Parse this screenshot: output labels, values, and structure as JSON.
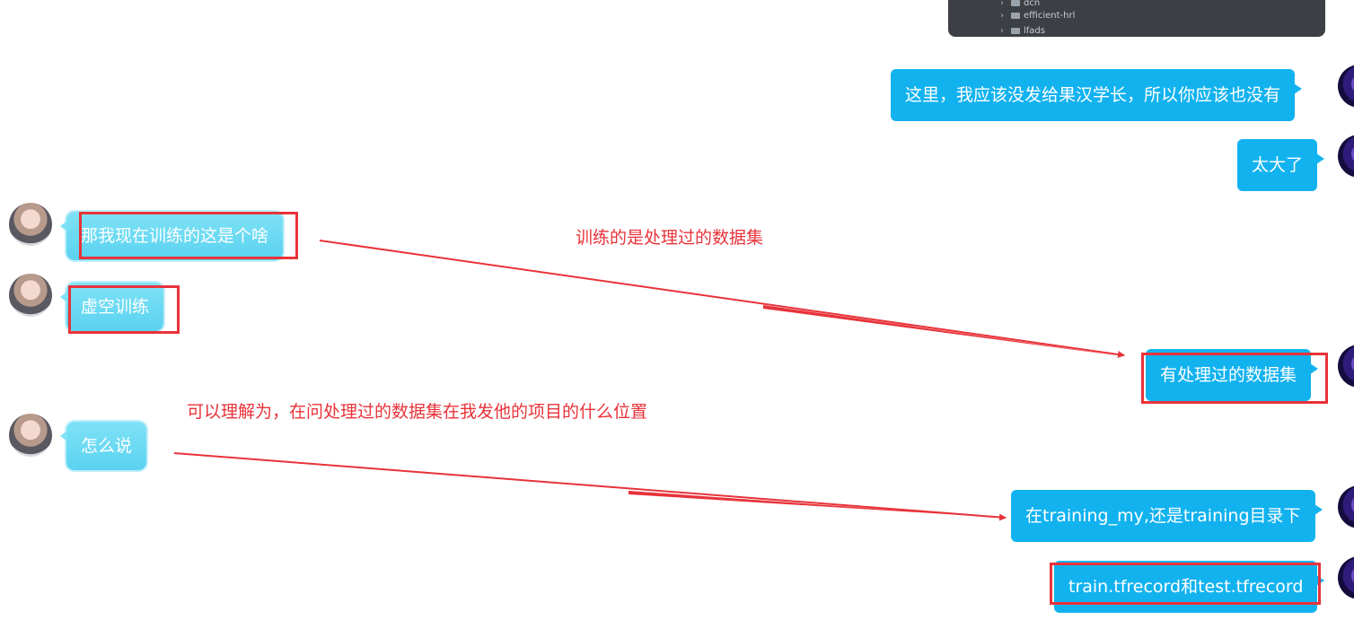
{
  "code_panel": {
    "tree_items": [
      "dcn",
      "efficient-hrl",
      "lfads"
    ]
  },
  "messages": {
    "m1": "这里，我应该没发给果汉学长，所以你应该也没有",
    "m2": "太大了",
    "m3": "那我现在训练的这是个啥",
    "m4": "虚空训练",
    "m5": "有处理过的数据集",
    "m6": "怎么说",
    "m7": "在training_my,还是training目录下",
    "m8": "train.tfrecord和test.tfrecord"
  },
  "annotations": {
    "a1": "训练的是处理过的数据集",
    "a2": "可以理解为，在问处理过的数据集在我发他的项目的什么位置"
  },
  "colors": {
    "outgoing_bubble": "#12b2ef",
    "incoming_bubble": "#5ad2f0",
    "annotation_red": "#e8333a",
    "code_panel_bg": "#3c3f44"
  }
}
